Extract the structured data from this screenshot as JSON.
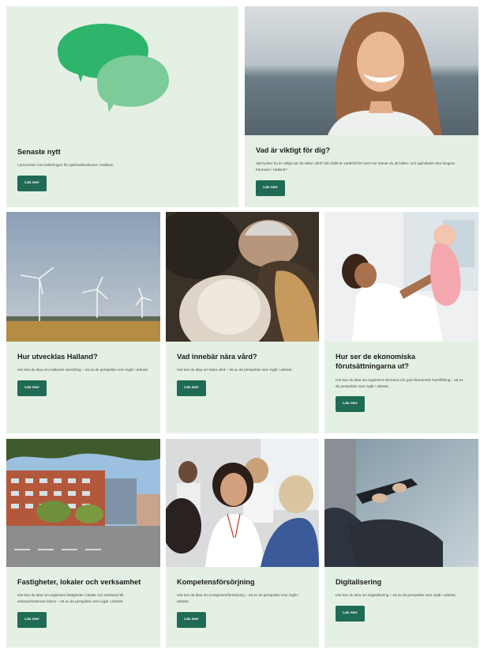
{
  "cards": [
    {
      "title": "Senaste nytt",
      "text": "I processen mot inriktningen för sjukhusstrukturen i Halland.",
      "button": "Läs mer",
      "image": "speech-bubbles-icon"
    },
    {
      "title": "Vad är viktigt för dig?",
      "text": "Vad tycker du är viktigt när du söker vård? Din åsikt är värdefull för oss! Hur ämnar du att hälso- och sjukvården ska fungera framöver i Halland?",
      "button": "Läs mer",
      "image": "smiling-girl-photo"
    },
    {
      "title": "Hur utvecklas Halland?",
      "text": "Här kan du läsa om Hallands utveckling – ett av de perspektiv som ingår i arbetet.",
      "button": "Läs mer",
      "image": "wind-turbines-photo"
    },
    {
      "title": "Vad innebär nära vård?",
      "text": "Här kan du läsa om Nära vård – ett av de perspektiv som ingår i arbetet.",
      "button": "Läs mer",
      "image": "care-meeting-photo"
    },
    {
      "title": "Hur ser de ekonomiska förutsättningarna ut?",
      "text": "Här kan du läsa om regionens ekonomi och god ekonomisk hushållning – ett av de perspektiv som ingår i arbetet.",
      "button": "Läs mer",
      "image": "mother-baby-photo"
    },
    {
      "title": "Fastigheter, lokaler och verksamhet",
      "text": "Här kan du läsa om regionens fastigheter, lokaler och samband till verksamheternas behov – ett av de perspektiv som ingår i arbetet.",
      "button": "Läs mer",
      "image": "hospital-building-photo"
    },
    {
      "title": "Kompetensförsörjning",
      "text": "Här kan du läsa om Kompetensförsörjning – ett av de perspektiv som ingår i arbetet.",
      "button": "Läs mer",
      "image": "healthcare-staff-photo"
    },
    {
      "title": "Digitalisering",
      "text": "Här kan du läsa om Digitalisering – ett av de perspektiv som ingår i arbetet.",
      "button": "Läs mer",
      "image": "tablet-user-photo"
    }
  ],
  "colors": {
    "card_background": "#e4f0e3",
    "button": "#1f6b56",
    "bubble_dark": "#2fb46b",
    "bubble_light": "#7ccb98"
  }
}
